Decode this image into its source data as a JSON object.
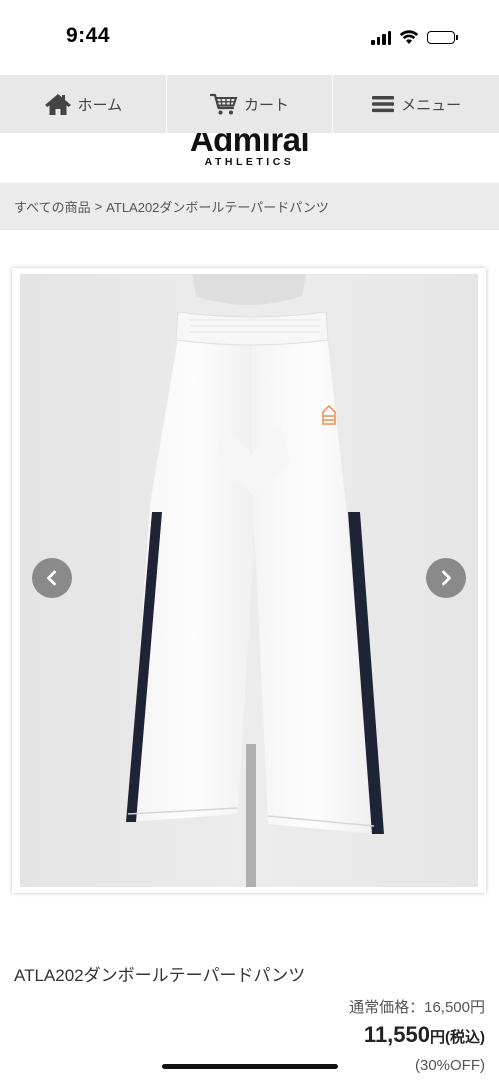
{
  "status_bar": {
    "time": "9:44"
  },
  "nav": {
    "home_label": "ホーム",
    "cart_label": "カート",
    "menu_label": "メニュー"
  },
  "brand": {
    "logo": "Admiral",
    "subtitle": "ATHLETICS"
  },
  "breadcrumb": {
    "root": "すべての商品",
    "separator": ">",
    "current": "ATLA202ダンボールテーパードパンツ"
  },
  "product": {
    "name": "ATLA202ダンボールテーパードパンツ",
    "regular_price": "通常価格：16,500円",
    "sale_price_number": "11,550",
    "sale_price_unit": "円(税込)",
    "discount": "(30%OFF)"
  },
  "colors": {
    "nav_bg": "#e8e8e8",
    "breadcrumb_bg": "#ebebeb",
    "arrow_bg": "#8a8a8a",
    "pants_stripe": "#1e2436",
    "logo_accent": "#f08a4b"
  }
}
